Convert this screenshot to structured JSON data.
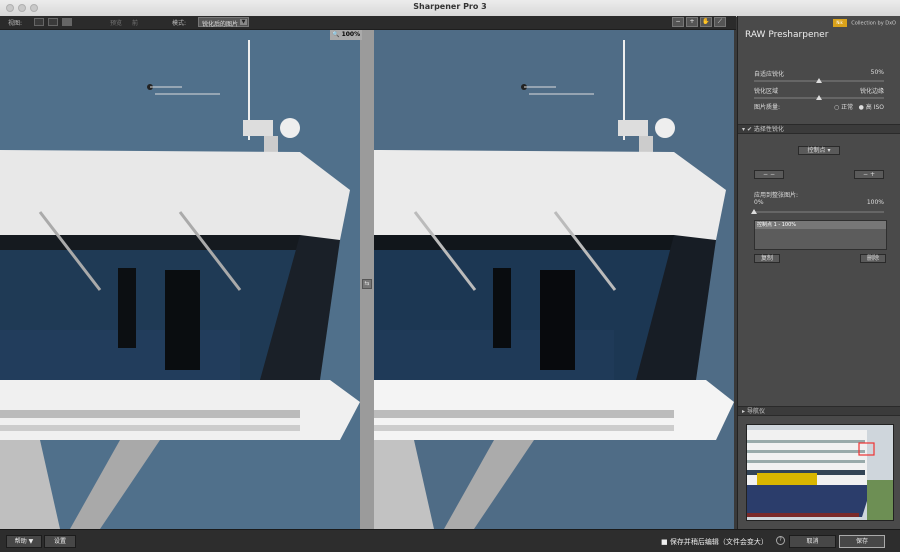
{
  "window": {
    "title": "Sharpener Pro 3"
  },
  "toolbar": {
    "view_label": "视图:",
    "preview_label": "预览",
    "before_label": "前",
    "mode_label": "模式:",
    "mode_value": "锐化后的图片",
    "zoom_level": "100%"
  },
  "panel": {
    "brand_text": "Collection by DxO",
    "brand_badge": "Nik",
    "title": "RAW Presharpener",
    "adaptive": {
      "label": "自适应锐化",
      "value": "50%",
      "level": 0.5
    },
    "area": {
      "label": "锐化区域",
      "right_label": "锐化边缘",
      "level": 0.5
    },
    "quality": {
      "label": "图片质量:",
      "normal": "正常",
      "high": "高 ISO",
      "selected": "high"
    },
    "selective": {
      "title": "选择性锐化"
    },
    "control_select": "控制点",
    "apply_label": "应用到整张图片:",
    "apply_min": "0%",
    "apply_max": "100%",
    "apply_level": 0.0,
    "list_item": "控制点 1 - 100%",
    "copy_button": "复制",
    "delete_button": "删除",
    "navigator": {
      "title": "导航仪"
    }
  },
  "footer": {
    "help_button": "帮助 ▼",
    "settings_button": "设置",
    "save_check": "保存并稍后编辑（文件会变大）",
    "cancel_button": "取消",
    "save_button": "保存"
  },
  "colors": {
    "sky": "#4f6c86",
    "panel": "#4a4a4a",
    "brand": "#d9a21b"
  }
}
